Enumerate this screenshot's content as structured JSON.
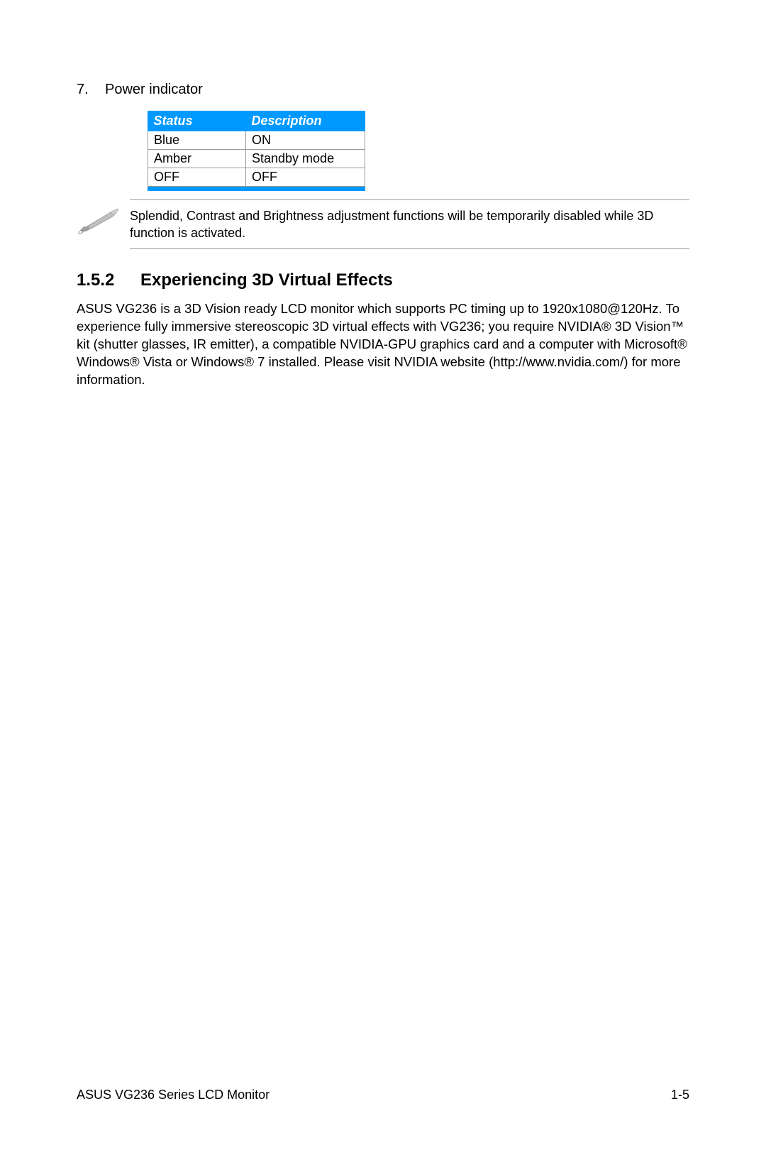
{
  "list": {
    "number": "7.",
    "title": "Power indicator"
  },
  "table": {
    "headers": {
      "status": "Status",
      "description": "Description"
    },
    "rows": [
      {
        "status": "Blue",
        "description": "ON"
      },
      {
        "status": "Amber",
        "description": "Standby mode"
      },
      {
        "status": "OFF",
        "description": "OFF"
      }
    ]
  },
  "note": {
    "text": "Splendid, Contrast and Brightness adjustment functions will be temporarily disabled while 3D function is activated."
  },
  "section": {
    "number": "1.5.2",
    "title": "Experiencing 3D Virtual Effects",
    "body": "ASUS VG236 is a 3D Vision ready LCD monitor which supports PC timing up to 1920x1080@120Hz. To experience fully immersive stereoscopic 3D virtual effects with VG236; you require NVIDIA® 3D Vision™ kit (shutter glasses, IR emitter), a compatible NVIDIA-GPU graphics card and a computer with Microsoft® Windows® Vista or Windows® 7 installed. Please visit NVIDIA website (http://www.nvidia.com/) for more information."
  },
  "footer": {
    "left": "ASUS VG236 Series LCD Monitor",
    "right": "1-5"
  }
}
